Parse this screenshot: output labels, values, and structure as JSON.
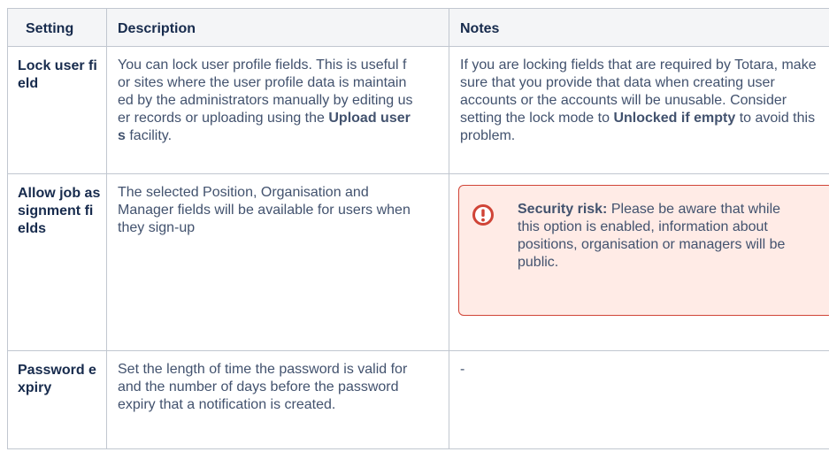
{
  "table": {
    "headers": {
      "setting": "Setting",
      "description": "Description",
      "notes": "Notes"
    },
    "rows": [
      {
        "setting": "Lock user field",
        "description": {
          "before": "You can lock user profile fields. This is useful for sites where the user profile data is maintained by the administrators manually by editing user records or uploading using the ",
          "bold": "Upload users",
          "after": " facility."
        },
        "notes": {
          "before": "If you are locking fields that are required by Totara, make sure that you provide that data when creating user accounts or the accounts will be unusable. Consider setting the lock mode to ",
          "bold": "Unlocked if empty",
          "after": " to avoid this problem."
        }
      },
      {
        "setting": "Allow job assignment fields",
        "description": "The selected Position, Organisation and Manager fields will be available for users when they sign-up",
        "notes": {
          "callout": {
            "type": "warning",
            "icon": "exclamation-circle-icon",
            "bold": "Security risk:",
            "text": " Please be aware that while this option is enabled, information about positions, organisation or managers will be public.",
            "border_color": "#d04437",
            "background_color": "#ffebe6"
          }
        }
      },
      {
        "setting": "Password expiry",
        "description": "Set the length of time the password is valid for and the number of days before the password expiry that a notification is created.",
        "notes": "-"
      }
    ]
  },
  "colors": {
    "header_bg": "#f4f5f7",
    "border": "#c1c7d0",
    "heading_text": "#172b4d",
    "body_text": "#42526e",
    "warning_icon": "#d04437"
  }
}
